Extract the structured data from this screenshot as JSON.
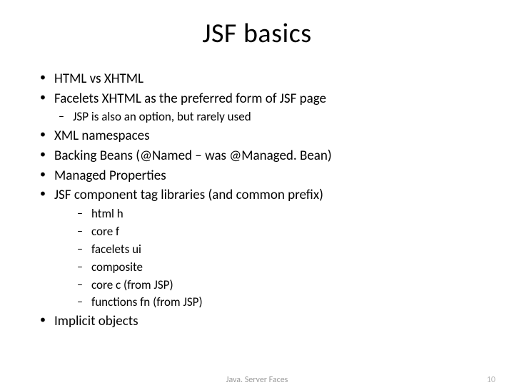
{
  "title": "JSF basics",
  "bullets": {
    "b1": "HTML vs XHTML",
    "b2": "Facelets XHTML as the preferred form of JSF page",
    "b2_1": "JSP is also an option, but rarely used",
    "b3": "XML namespaces",
    "b4": "Backing Beans (@Named – was @Managed. Bean)",
    "b5": "Managed Properties",
    "b6": "JSF component tag libraries (and common prefix)",
    "b6_1": "html h",
    "b6_2": "core f",
    "b6_3": "facelets ui",
    "b6_4": "composite",
    "b6_5": "core c (from JSP)",
    "b6_6": "functions fn (from JSP)",
    "b7": "Implicit objects"
  },
  "footer": {
    "center": "Java. Server Faces",
    "page": "10"
  }
}
